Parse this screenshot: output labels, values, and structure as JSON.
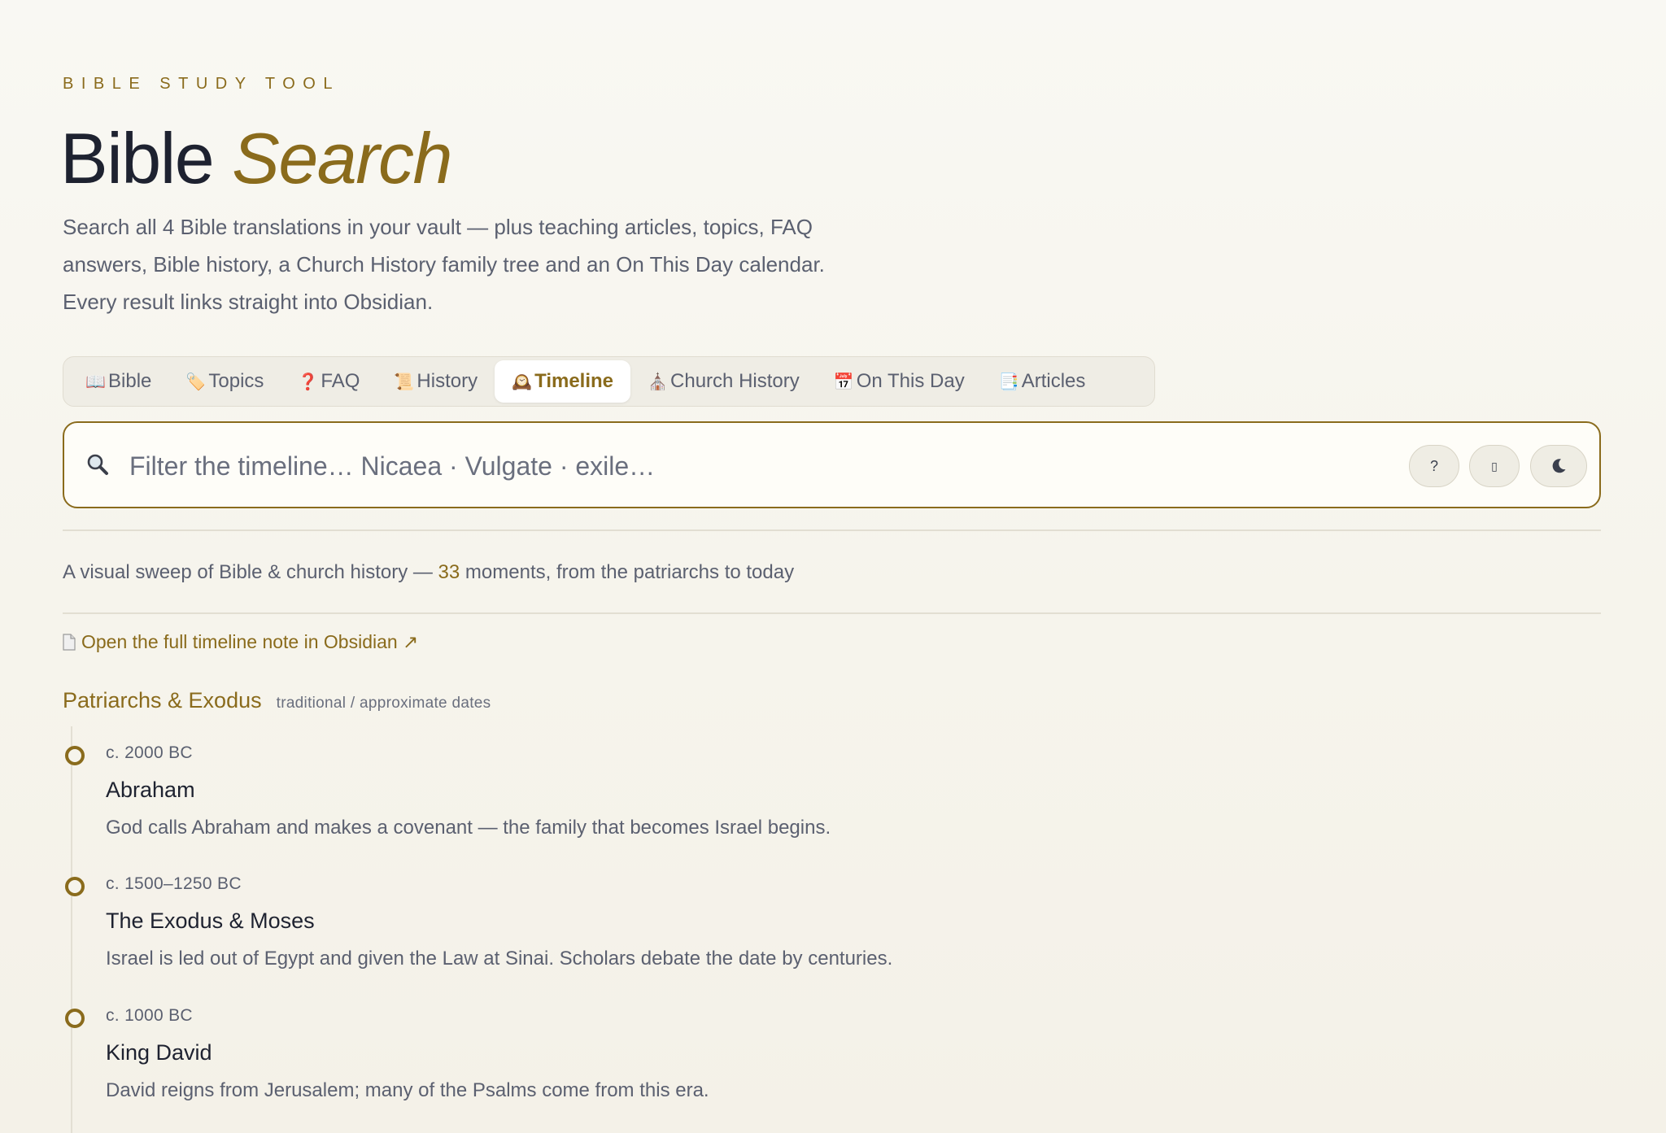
{
  "header": {
    "eyebrow": "BIBLE STUDY TOOL",
    "title_main": "Bible",
    "title_accent": "Search",
    "intro_lines": [
      "Search all 4 Bible translations in your vault — plus teaching articles, topics, FAQ",
      "answers, Bible history, a Church History family tree and an On This Day calendar.",
      "Every result links straight into Obsidian."
    ]
  },
  "tabs": [
    {
      "icon": "open-book-icon",
      "glyph": "📖",
      "label": "Bible",
      "active": false
    },
    {
      "icon": "tag-icon",
      "glyph": "🏷️",
      "label": "Topics",
      "active": false
    },
    {
      "icon": "question-icon",
      "glyph": "❓",
      "label": "FAQ",
      "active": false
    },
    {
      "icon": "scroll-icon",
      "glyph": "📜",
      "label": "History",
      "active": false
    },
    {
      "icon": "clock-icon",
      "glyph": "🕰️",
      "label": "Timeline",
      "active": true
    },
    {
      "icon": "church-icon",
      "glyph": "⛪",
      "label": "Church History",
      "active": false
    },
    {
      "icon": "calendar-icon",
      "glyph": "📅",
      "label": "On This Day",
      "active": false
    },
    {
      "icon": "document-icon",
      "glyph": "📑",
      "label": "Articles",
      "active": false
    }
  ],
  "search": {
    "value": "",
    "placeholder": "Filter the timeline… Nicaea · Vulgate · exile…",
    "help_label": "?",
    "layout_label": "▯",
    "theme_icon": "moon-icon"
  },
  "summary": {
    "prefix": "A visual sweep of Bible & church history — ",
    "count": "33",
    "suffix": " moments, from the patriarchs to today"
  },
  "open_link": "Open the full timeline note in Obsidian ↗",
  "era": {
    "name": "Patriarchs & Exodus",
    "note": "traditional / approximate dates"
  },
  "events": [
    {
      "date": "c. 2000 BC",
      "name": "Abraham",
      "desc": "God calls Abraham and makes a covenant — the family that becomes Israel begins."
    },
    {
      "date": "c. 1500–1250 BC",
      "name": "The Exodus & Moses",
      "desc": "Israel is led out of Egypt and given the Law at Sinai. Scholars debate the date by centuries."
    },
    {
      "date": "c. 1000 BC",
      "name": "King David",
      "desc": "David reigns from Jerusalem; many of the Psalms come from this era."
    }
  ],
  "colors": {
    "accent": "#8a6b1c",
    "text": "#1e2230",
    "muted": "#5b6070",
    "background": "#f6f4ec"
  }
}
